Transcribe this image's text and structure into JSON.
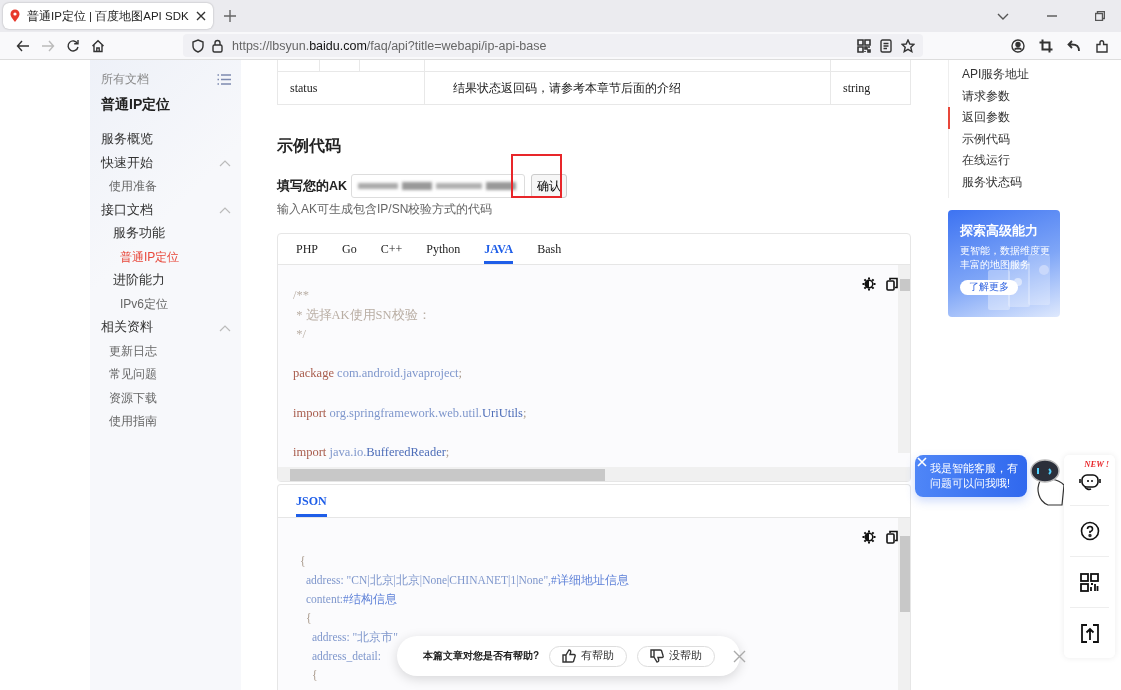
{
  "browser": {
    "tab_title": "普通IP定位 | 百度地图API SDK",
    "url": "https://lbsyun.**baidu.com**/faq/api?title=webapi/ip-api-base",
    "back_disabled": false,
    "forward_disabled": true
  },
  "sidebar": {
    "heading": "所有文档",
    "title": "普通IP定位",
    "items": [
      {
        "label": "服务概览",
        "selected": false
      },
      {
        "label": "快速开始",
        "selected": false,
        "expanded": true,
        "children": [
          {
            "label": "使用准备",
            "selected": false
          }
        ]
      },
      {
        "label": "接口文档",
        "selected": false,
        "expanded": true,
        "children": [
          {
            "label": "服务功能",
            "selected": false,
            "children": [
              {
                "label": "普通IP定位",
                "selected": true
              }
            ]
          },
          {
            "label": "进阶能力",
            "selected": false,
            "children": [
              {
                "label": "IPv6定位",
                "selected": false
              }
            ]
          }
        ]
      },
      {
        "label": "相关资料",
        "selected": false,
        "expanded": true,
        "children": [
          {
            "label": "更新日志",
            "selected": false
          },
          {
            "label": "常见问题",
            "selected": false
          },
          {
            "label": "资源下载",
            "selected": false
          },
          {
            "label": "使用指南",
            "selected": false
          }
        ]
      }
    ]
  },
  "table": {
    "rows": [
      [
        "status",
        "结果状态返回码，请参考本章节后面的介绍",
        "string"
      ]
    ]
  },
  "example": {
    "heading": "示例代码",
    "ak_label": "填写您的AK",
    "confirm": "确认",
    "highlighted": true,
    "hint": "输入AK可生成包含IP/SN校验方式的代码",
    "code_tabs": [
      {
        "label": "PHP",
        "selected": false
      },
      {
        "label": "Go",
        "selected": false
      },
      {
        "label": "C++",
        "selected": false
      },
      {
        "label": "Python",
        "selected": false
      },
      {
        "label": "JAVA",
        "selected": true
      },
      {
        "label": "Bash",
        "selected": false
      }
    ],
    "code": [
      {
        "segments": [
          {
            "text": "/**",
            "kind": "comment"
          }
        ]
      },
      {
        "segments": [
          {
            "text": " * 选择AK使用SN校验：",
            "kind": "comment"
          }
        ]
      },
      {
        "segments": [
          {
            "text": " */",
            "kind": "comment"
          }
        ]
      },
      {
        "blank_before": true,
        "segments": [
          {
            "text": "package ",
            "kind": "keyword"
          },
          {
            "text": "com.android.javaproject",
            "kind": "name"
          },
          {
            "text": ";",
            "kind": "punct"
          }
        ]
      },
      {
        "blank_before": true,
        "segments": [
          {
            "text": "import ",
            "kind": "keyword"
          },
          {
            "text": "org.springframework.web.util.",
            "kind": "name"
          },
          {
            "text": "UriUtils",
            "kind": "class"
          },
          {
            "text": ";",
            "kind": "punct"
          }
        ]
      },
      {
        "blank_before": true,
        "segments": [
          {
            "text": "import ",
            "kind": "keyword"
          },
          {
            "text": "java.io.",
            "kind": "name"
          },
          {
            "text": "BufferedReader",
            "kind": "class"
          },
          {
            "text": ";",
            "kind": "punct"
          }
        ]
      }
    ],
    "result_tabs": [
      {
        "label": "JSON",
        "selected": true
      }
    ],
    "result": [
      {
        "segments": [
          {
            "text": "{",
            "kind": "punct"
          }
        ],
        "children": [
          {
            "segments": [
              {
                "text": "address: \"CN|北京|北京|None|CHINANET|1|None\",",
                "kind": "name"
              },
              {
                "text": "#详细地址信息",
                "kind": "remark"
              }
            ]
          },
          {
            "segments": [
              {
                "text": "content:",
                "kind": "name"
              },
              {
                "text": "#结构信息",
                "kind": "remark"
              }
            ]
          },
          {
            "segments": [
              {
                "text": "{",
                "kind": "punct"
              }
            ],
            "children": [
              {
                "segments": [
                  {
                    "text": "address: \"北京市\"",
                    "kind": "name"
                  }
                ]
              },
              {
                "segments": [
                  {
                    "text": "address_detail:",
                    "kind": "name"
                  }
                ]
              },
              {
                "segments": [
                  {
                    "text": "{",
                    "kind": "punct"
                  }
                ]
              }
            ]
          }
        ]
      }
    ]
  },
  "toc": {
    "items": [
      {
        "label": "API服务地址",
        "selected": false
      },
      {
        "label": "请求参数",
        "selected": false
      },
      {
        "label": "返回参数",
        "selected": true
      },
      {
        "label": "示例代码",
        "selected": false
      },
      {
        "label": "在线运行",
        "selected": false
      },
      {
        "label": "服务状态码",
        "selected": false
      }
    ]
  },
  "banner": {
    "title": "探索高级能力",
    "text": "更智能，数据维度更丰富的地图服务",
    "button": "了解更多"
  },
  "assistant": {
    "message": "我是智能客服，有问题可以问我哦!",
    "badge": "NEW !"
  },
  "feedback": {
    "question": "本篇文章对您是否有帮助?",
    "yes": "有帮助",
    "no": "没帮助"
  }
}
